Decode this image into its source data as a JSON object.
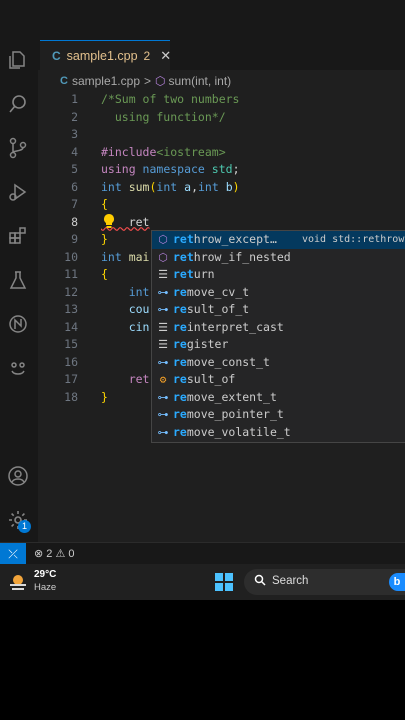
{
  "tab": {
    "lang_icon": "C",
    "filename": "sample1.cpp",
    "problems_count": "2",
    "close": "✕"
  },
  "breadcrumb": {
    "file": "sample1.cpp",
    "separator": ">",
    "symbol": "sum(int, int)"
  },
  "code_lines": [
    {
      "n": "1"
    },
    {
      "n": "2"
    },
    {
      "n": "3"
    },
    {
      "n": "4"
    },
    {
      "n": "5"
    },
    {
      "n": "6"
    },
    {
      "n": "7"
    },
    {
      "n": "8"
    },
    {
      "n": "9"
    },
    {
      "n": "10"
    },
    {
      "n": "11"
    },
    {
      "n": "12"
    },
    {
      "n": "13"
    },
    {
      "n": "14"
    },
    {
      "n": "15"
    },
    {
      "n": "16"
    },
    {
      "n": "17"
    },
    {
      "n": "18"
    }
  ],
  "code": {
    "l1": "/*Sum of two numbers",
    "l2": "  using function*/",
    "l4a": "#include",
    "l4b": "<iostream>",
    "l5a": "using",
    "l5b": " namespace",
    "l5c": " std",
    "l5d": ";",
    "l6a": "int",
    "l6b": " sum",
    "l6c": "(",
    "l6d": "int",
    "l6e": " a",
    "l6f": ",",
    "l6g": "int",
    "l6h": " b",
    "l6i": ")",
    "l7": "{",
    "l8": "    ret",
    "l9": "}",
    "l10a": "int",
    "l10b": " mai",
    "l11": "{",
    "l12": "    int",
    "l13": "    cou",
    "l14": "    cin",
    "l17": "    ret",
    "l18": "}"
  },
  "suggestions": [
    {
      "match": "ret",
      "rest": "hrow_except…",
      "detail": "void std::rethrow",
      "kind": "cube"
    },
    {
      "match": "ret",
      "rest": "hrow_if_nested",
      "detail": "",
      "kind": "cube"
    },
    {
      "match": "ret",
      "rest": "urn",
      "detail": "",
      "kind": "keyword"
    },
    {
      "match": "re",
      "rest": "move_cv_t",
      "detail": "",
      "kind": "variable"
    },
    {
      "match": "re",
      "rest": "sult_of_t",
      "detail": "",
      "kind": "variable"
    },
    {
      "match": "re",
      "rest": "interpret_cast",
      "detail": "",
      "kind": "keyword"
    },
    {
      "match": "re",
      "rest": "gister",
      "detail": "",
      "kind": "keyword"
    },
    {
      "match": "re",
      "rest": "move_const_t",
      "detail": "",
      "kind": "variable"
    },
    {
      "match": "re",
      "rest": "sult_of",
      "detail": "",
      "kind": "class"
    },
    {
      "match": "re",
      "rest": "move_extent_t",
      "detail": "",
      "kind": "variable"
    },
    {
      "match": "re",
      "rest": "move_pointer_t",
      "detail": "",
      "kind": "variable"
    },
    {
      "match": "re",
      "rest": "move_volatile_t",
      "detail": "",
      "kind": "variable"
    }
  ],
  "status": {
    "errors": "2",
    "warnings": "0"
  },
  "activity": {
    "settings_badge": "1"
  },
  "taskbar": {
    "temp": "29°C",
    "condition": "Haze",
    "search_label": "Search"
  },
  "colors": {
    "accent": "#0078d4",
    "editor_bg": "#1f1f1f"
  }
}
